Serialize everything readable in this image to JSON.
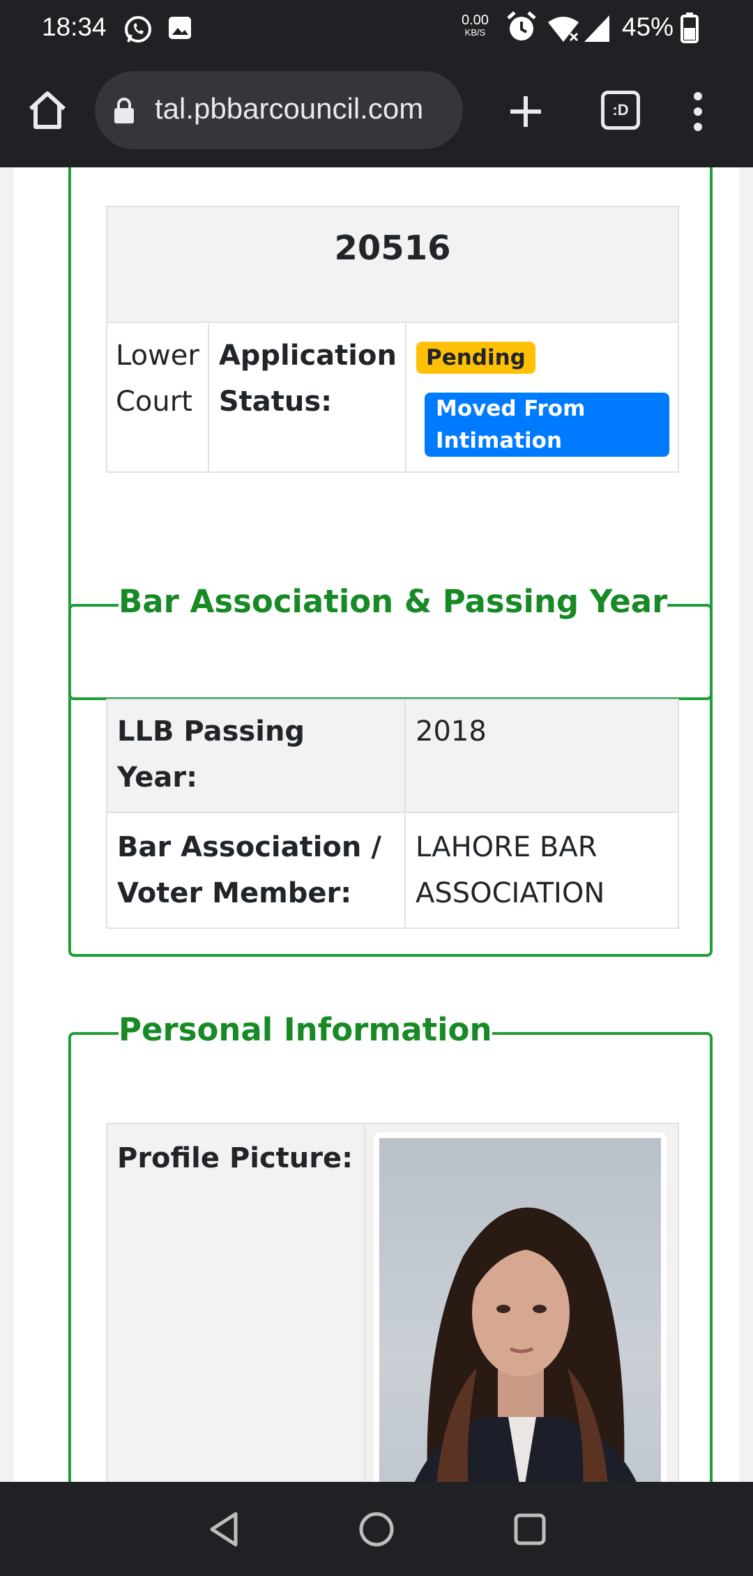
{
  "status_bar": {
    "time": "18:34",
    "net_speed_value": "0.00",
    "net_speed_unit": "KB/S",
    "battery_percent": "45%"
  },
  "browser": {
    "url": "tal.pbbarcouncil.com",
    "tabs_label": ":D"
  },
  "application": {
    "id": "20516",
    "court": "Lower Court",
    "status_label": "Application Status:",
    "badges": [
      "Pending",
      "Moved From Intimation"
    ]
  },
  "bar_section": {
    "legend": "Bar Association & Passing Year",
    "rows": [
      {
        "label": "LLB Passing Year:",
        "value": "2018"
      },
      {
        "label": "Bar Association / Voter Member:",
        "value": "LAHORE BAR ASSOCIATION"
      }
    ]
  },
  "personal_section": {
    "legend": "Personal Information",
    "profile_label": "Profile Picture:"
  },
  "colors": {
    "section_green": "#1f9d36",
    "legend_green": "#178a26",
    "badge_warning": "#ffc107",
    "badge_primary": "#007bff",
    "chrome_dark": "#202124"
  }
}
